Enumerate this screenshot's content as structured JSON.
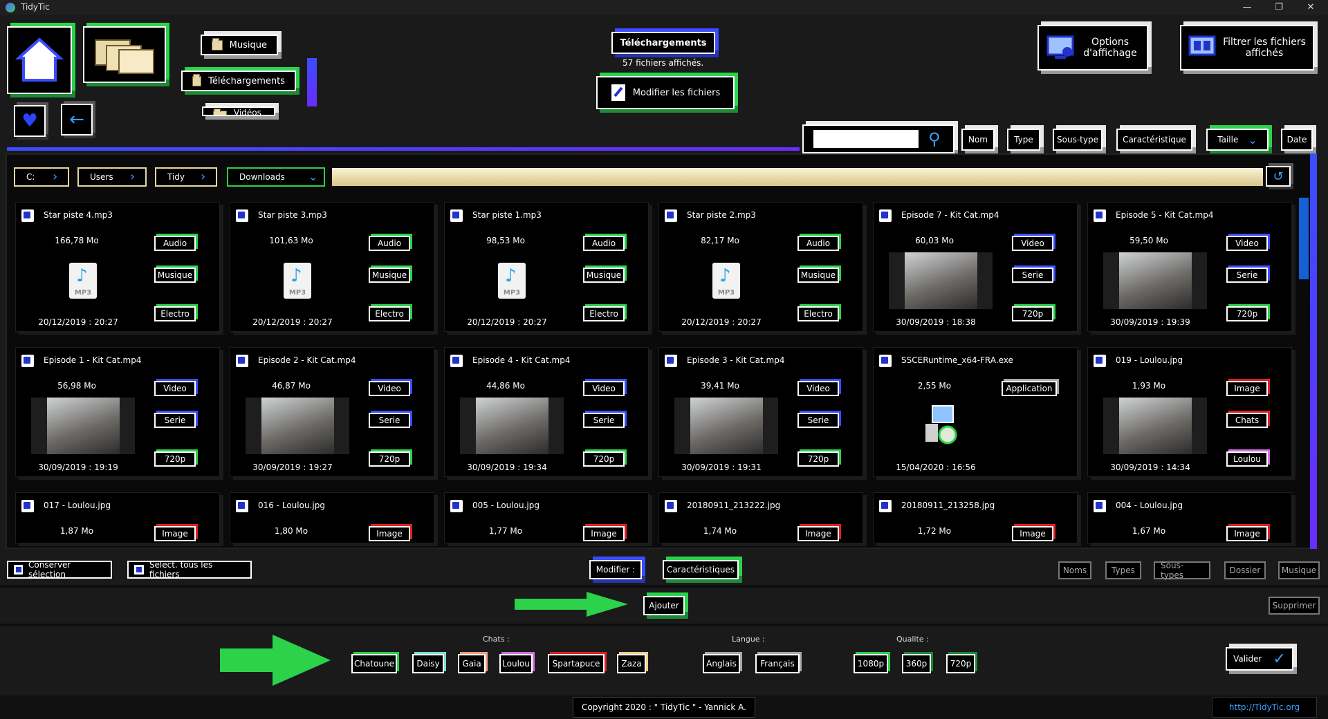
{
  "window": {
    "title": "TidyTic",
    "minimize": "—",
    "maximize": "❐",
    "close": "✕"
  },
  "header": {
    "folders": [
      "Musique",
      "Téléchargements",
      "Vidéos"
    ],
    "current_folder": "Téléchargements",
    "file_count": "57 fichiers affichés.",
    "modify_files": "Modifier les fichiers",
    "display_options": "Options d'affichage",
    "filter_files": "Filtrer les fichiers affichés"
  },
  "search": {
    "value": ""
  },
  "sort": [
    "Nom",
    "Type",
    "Sous-type",
    "Caractéristique",
    "Taille",
    "Date"
  ],
  "breadcrumb": [
    "C:",
    "Users",
    "Tidy",
    "Downloads"
  ],
  "files": [
    {
      "name": "Star piste 4.mp3",
      "size": "166,78 Mo",
      "date": "20/12/2019 : 20:27",
      "tags": [
        "Audio",
        "Musique",
        "Electro"
      ],
      "kind": "mp3"
    },
    {
      "name": "Star piste 3.mp3",
      "size": "101,63 Mo",
      "date": "20/12/2019 : 20:27",
      "tags": [
        "Audio",
        "Musique",
        "Electro"
      ],
      "kind": "mp3"
    },
    {
      "name": "Star piste 1.mp3",
      "size": "98,53 Mo",
      "date": "20/12/2019 : 20:27",
      "tags": [
        "Audio",
        "Musique",
        "Electro"
      ],
      "kind": "mp3"
    },
    {
      "name": "Star piste 2.mp3",
      "size": "82,17 Mo",
      "date": "20/12/2019 : 20:27",
      "tags": [
        "Audio",
        "Musique",
        "Electro"
      ],
      "kind": "mp3"
    },
    {
      "name": "Episode 7 - Kit Cat.mp4",
      "size": "60,03 Mo",
      "date": "30/09/2019 : 18:38",
      "tags": [
        "Video",
        "Serie",
        "720p"
      ],
      "kind": "video"
    },
    {
      "name": "Episode 5 - Kit Cat.mp4",
      "size": "59,50 Mo",
      "date": "30/09/2019 : 19:39",
      "tags": [
        "Video",
        "Serie",
        "720p"
      ],
      "kind": "video"
    },
    {
      "name": "Episode 1 - Kit Cat.mp4",
      "size": "56,98 Mo",
      "date": "30/09/2019 : 19:19",
      "tags": [
        "Video",
        "Serie",
        "720p"
      ],
      "kind": "video"
    },
    {
      "name": "Episode 2 - Kit Cat.mp4",
      "size": "46,87 Mo",
      "date": "30/09/2019 : 19:27",
      "tags": [
        "Video",
        "Serie",
        "720p"
      ],
      "kind": "video"
    },
    {
      "name": "Episode 4 - Kit Cat.mp4",
      "size": "44,86 Mo",
      "date": "30/09/2019 : 19:34",
      "tags": [
        "Video",
        "Serie",
        "720p"
      ],
      "kind": "video"
    },
    {
      "name": "Episode 3 - Kit Cat.mp4",
      "size": "39,41 Mo",
      "date": "30/09/2019 : 19:31",
      "tags": [
        "Video",
        "Serie",
        "720p"
      ],
      "kind": "video"
    },
    {
      "name": "SSCERuntime_x64-FRA.exe",
      "size": "2,55 Mo",
      "date": "15/04/2020 : 16:56",
      "tags": [
        "Application"
      ],
      "kind": "exe"
    },
    {
      "name": "019 - Loulou.jpg",
      "size": "1,93 Mo",
      "date": "30/09/2019 : 14:34",
      "tags": [
        "Image",
        "Chats",
        "Loulou"
      ],
      "kind": "image"
    },
    {
      "name": "017 - Loulou.jpg",
      "size": "1,87 Mo",
      "date": "",
      "tags": [
        "Image"
      ],
      "kind": "image"
    },
    {
      "name": "016 - Loulou.jpg",
      "size": "1,80 Mo",
      "date": "",
      "tags": [
        "Image"
      ],
      "kind": "image"
    },
    {
      "name": "005 - Loulou.jpg",
      "size": "1,77 Mo",
      "date": "",
      "tags": [
        "Image"
      ],
      "kind": "image"
    },
    {
      "name": "20180911_213222.jpg",
      "size": "1,74 Mo",
      "date": "",
      "tags": [
        "Image"
      ],
      "kind": "image"
    },
    {
      "name": "20180911_213258.jpg",
      "size": "1,72 Mo",
      "date": "",
      "tags": [
        "Image"
      ],
      "kind": "image"
    },
    {
      "name": "004 - Loulou.jpg",
      "size": "1,67 Mo",
      "date": "",
      "tags": [
        "Image"
      ],
      "kind": "image"
    }
  ],
  "actions": {
    "keep_selection": "Conserver sélection",
    "select_all": "Select. tous les fichiers",
    "modify": "Modifier :",
    "characteristics": "Caractéristiques",
    "names": "Noms",
    "types": "Types",
    "subtypes": "Sous-types",
    "folder": "Dossier",
    "music": "Musique",
    "add": "Ajouter",
    "delete": "Supprimer"
  },
  "groups": {
    "cats_label": "Chats :",
    "cats": [
      "Chatoune",
      "Daisy",
      "Gaia",
      "Loulou",
      "Spartapuce",
      "Zaza"
    ],
    "lang_label": "Langue :",
    "langs": [
      "Anglais",
      "Français"
    ],
    "quality_label": "Qualite :",
    "qualities": [
      "1080p",
      "360p",
      "720p"
    ],
    "validate": "Valider"
  },
  "footer": {
    "copyright": "Copyright 2020 : \" TidyTic \" - Yannick A.",
    "link": "http://TidyTic.org"
  },
  "colors": {
    "accent_blue": "#3a4dff",
    "accent_green": "#2bd24a",
    "path_bar": "#f4e6b6",
    "arrow": "#2bd24a"
  }
}
